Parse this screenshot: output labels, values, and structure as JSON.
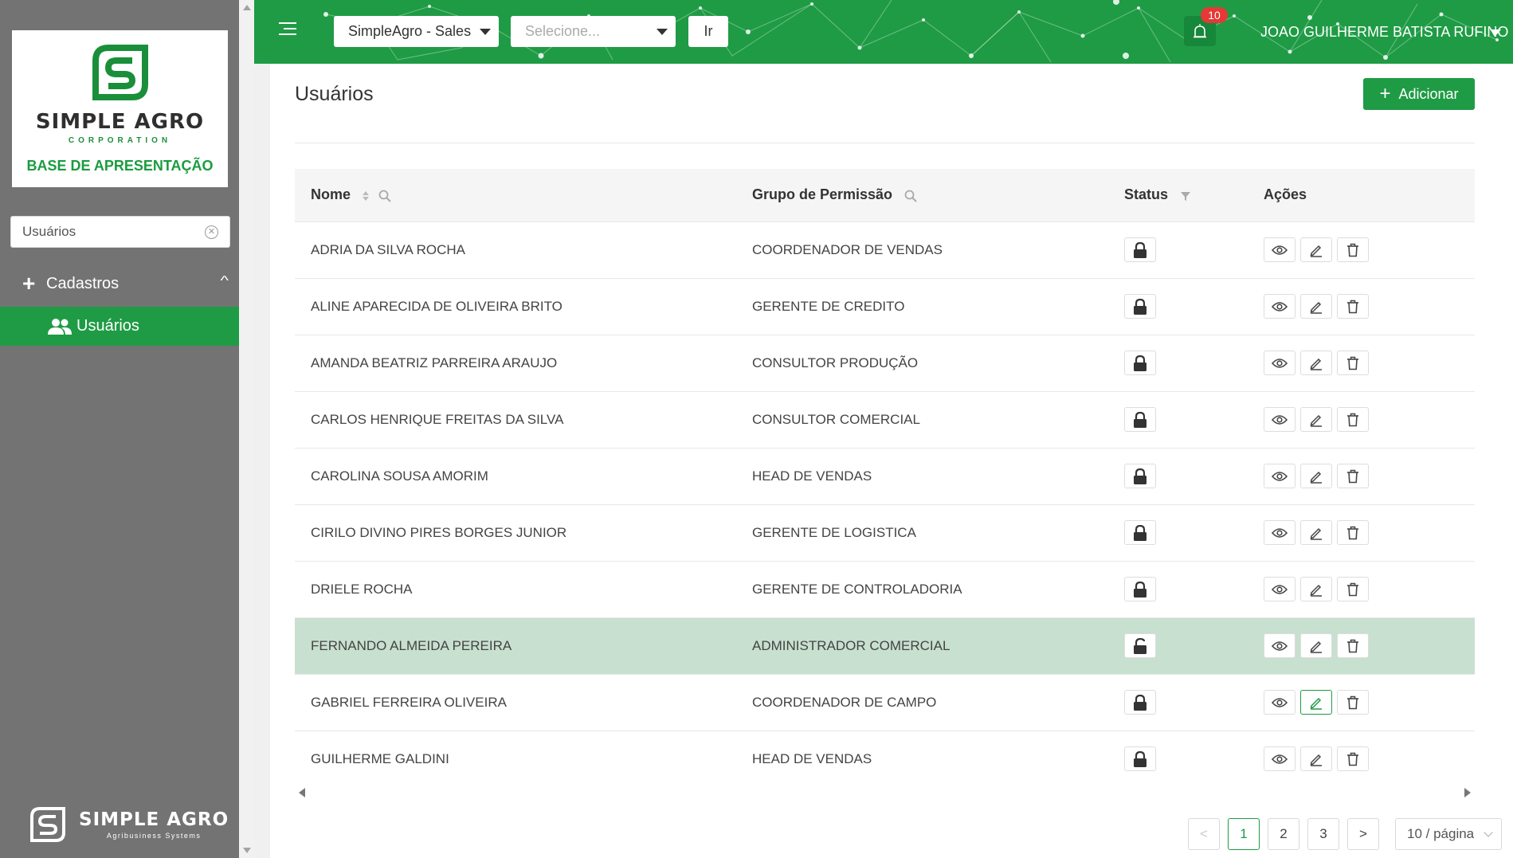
{
  "colors": {
    "brand_green": "#1f9b45",
    "sidebar_bg": "#737373",
    "selected_row": "#c8e0cf",
    "badge_red": "#e53935"
  },
  "sidebar": {
    "logo_name": "SIMPLE AGRO",
    "logo_corp": "CORPORATION",
    "logo_subtitle": "BASE DE APRESENTAÇÃO",
    "search_value": "Usuários",
    "group_label": "Cadastros",
    "item_label": "Usuários",
    "footer_name": "SIMPLE AGRO",
    "footer_tagline": "Agribusiness Systems"
  },
  "header": {
    "company_select": "SimpleAgro - Sales",
    "second_select_placeholder": "Selecione...",
    "go_label": "Ir",
    "notification_count": "10",
    "user_name": "JOAO GUILHERME BATISTA RUFINO"
  },
  "main": {
    "title": "Usuários",
    "add_label": "Adicionar",
    "columns": {
      "name": "Nome",
      "group": "Grupo de Permissão",
      "status": "Status",
      "actions": "Ações"
    },
    "rows": [
      {
        "name": "ADRIA DA SILVA ROCHA",
        "group": "COORDENADOR DE VENDAS",
        "status": "locked"
      },
      {
        "name": "ALINE APARECIDA DE OLIVEIRA BRITO",
        "group": "GERENTE DE CREDITO",
        "status": "locked"
      },
      {
        "name": "AMANDA BEATRIZ PARREIRA ARAUJO",
        "group": "CONSULTOR PRODUÇÃO",
        "status": "locked"
      },
      {
        "name": "CARLOS HENRIQUE FREITAS DA SILVA",
        "group": "CONSULTOR COMERCIAL",
        "status": "locked"
      },
      {
        "name": "CAROLINA SOUSA AMORIM",
        "group": "HEAD DE VENDAS",
        "status": "locked"
      },
      {
        "name": "CIRILO DIVINO PIRES BORGES JUNIOR",
        "group": "GERENTE DE LOGISTICA",
        "status": "locked"
      },
      {
        "name": "DRIELE ROCHA",
        "group": "GERENTE DE CONTROLADORIA",
        "status": "locked"
      },
      {
        "name": "FERNANDO ALMEIDA PEREIRA",
        "group": "ADMINISTRADOR COMERCIAL",
        "status": "unlocked"
      },
      {
        "name": "GABRIEL FERREIRA OLIVEIRA",
        "group": "COORDENADOR DE CAMPO",
        "status": "locked"
      },
      {
        "name": "GUILHERME GALDINI",
        "group": "HEAD DE VENDAS",
        "status": "locked"
      }
    ],
    "pagination": {
      "pages": [
        "1",
        "2",
        "3"
      ],
      "current": "1",
      "page_size": "10 / página"
    }
  }
}
